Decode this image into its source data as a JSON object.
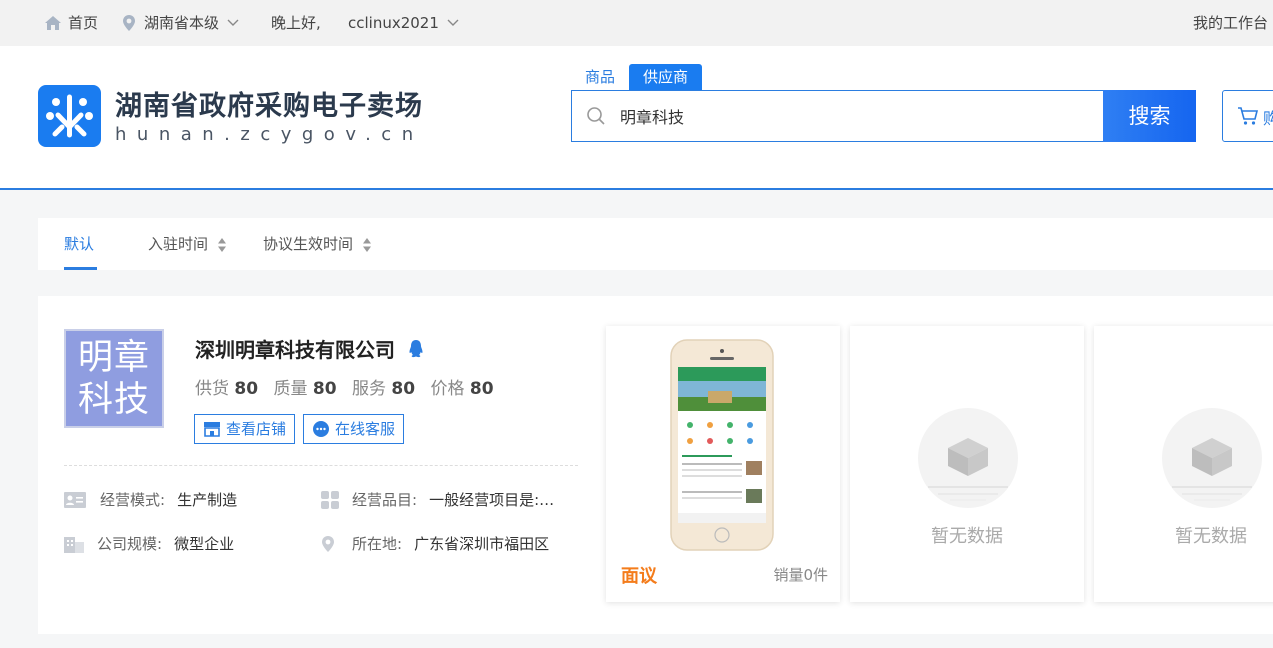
{
  "topbar": {
    "home": "首页",
    "region": "湖南省本级",
    "greeting": "晚上好,",
    "username": "cclinux2021",
    "workbench": "我的工作台"
  },
  "header": {
    "logo_title": "湖南省政府采购电子卖场",
    "logo_domain": "hunan.zcygov.cn",
    "search_tabs": [
      "商品",
      "供应商"
    ],
    "search_value": "明章科技",
    "search_button": "搜索",
    "cart_label": "购"
  },
  "sortbar": {
    "items": [
      "默认",
      "入驻时间",
      "协议生效时间"
    ]
  },
  "supplier": {
    "avatar_text_1": "明章",
    "avatar_text_2": "科技",
    "name": "深圳明章科技有限公司",
    "scores": [
      {
        "label": "供货",
        "value": "80"
      },
      {
        "label": "质量",
        "value": "80"
      },
      {
        "label": "服务",
        "value": "80"
      },
      {
        "label": "价格",
        "value": "80"
      }
    ],
    "view_shop": "查看店铺",
    "online_service": "在线客服",
    "mode_label": "经营模式:",
    "mode_value": "生产制造",
    "category_label": "经营品目:",
    "category_value": "一般经营项目是:…",
    "scale_label": "公司规模:",
    "scale_value": "微型企业",
    "location_label": "所在地:",
    "location_value": "广东省深圳市福田区"
  },
  "products": [
    {
      "price": "面议",
      "sales": "销量0件"
    },
    {
      "empty": "暂无数据"
    },
    {
      "empty": "暂无数据"
    }
  ],
  "colors": {
    "accent": "#2b7de0",
    "brand_blue": "#1a7cf0",
    "price_orange": "#f47c1b"
  }
}
